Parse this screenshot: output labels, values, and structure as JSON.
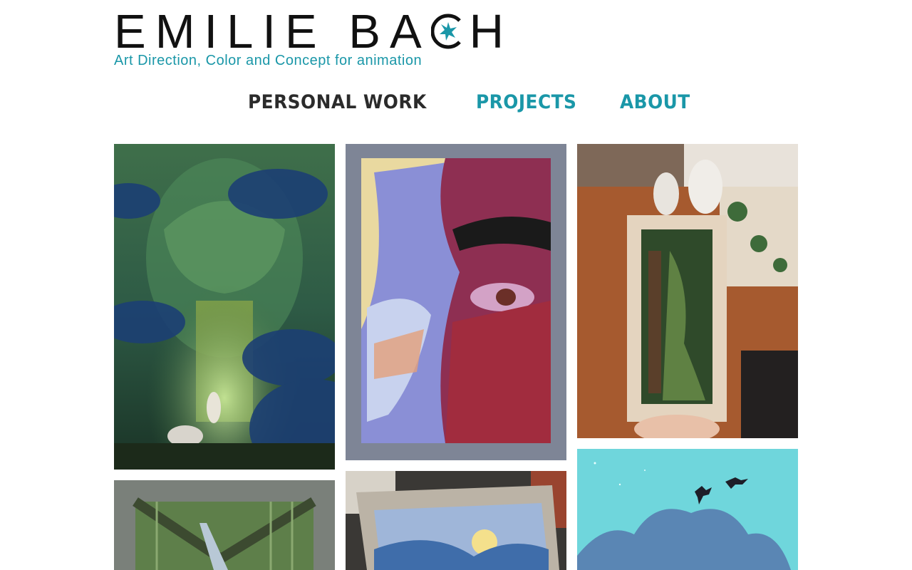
{
  "site": {
    "logo_left": "EMILIE BA",
    "logo_right": "H",
    "tagline": "Art Direction, Color and Concept for animation"
  },
  "nav": {
    "personal_work": "PERSONAL WORK",
    "projects": "PROJECTS",
    "about": "ABOUT"
  },
  "colors": {
    "accent": "#1a97a8",
    "text_dark": "#2b2b2b"
  },
  "icons": [
    "star-icon"
  ]
}
